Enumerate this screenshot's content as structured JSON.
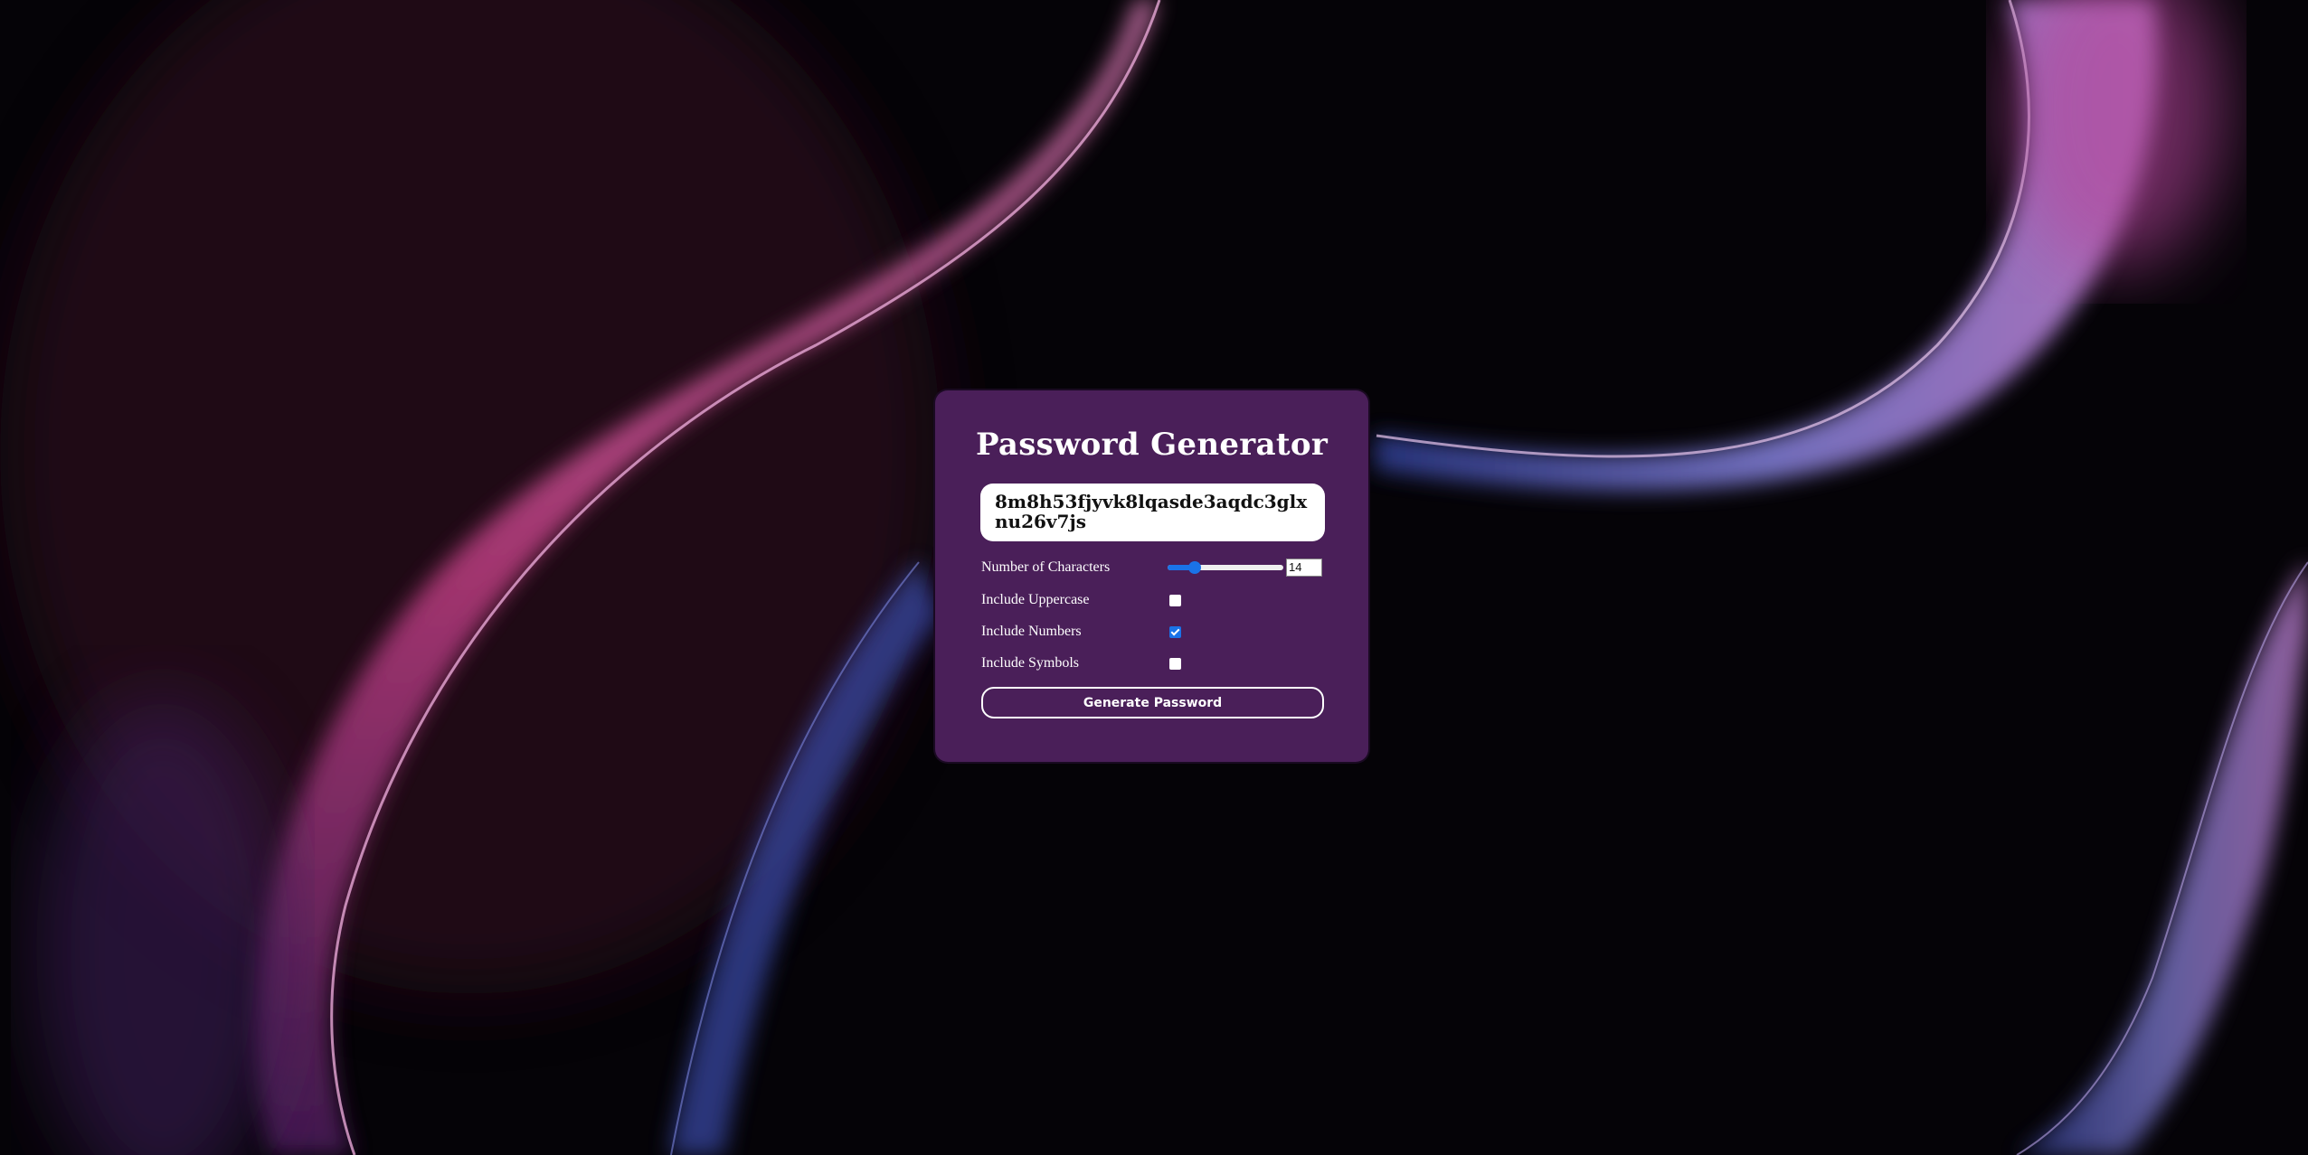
{
  "app": {
    "title": "Password Generator"
  },
  "password": {
    "value": "8m8h53fjyvk8lqasde3aqdc3glxnu26v7js"
  },
  "options": {
    "length_label": "Number of Characters",
    "length_value": "14",
    "length_slider": {
      "value": 14,
      "min": 6,
      "max": 40
    },
    "uppercase_label": "Include Uppercase",
    "uppercase_checked": false,
    "numbers_label": "Include Numbers",
    "numbers_checked": true,
    "symbols_label": "Include Symbols",
    "symbols_checked": false
  },
  "actions": {
    "generate_label": "Generate Password"
  },
  "colors": {
    "card_bg": "#4a1f59",
    "accent": "#1a73e8",
    "page_bg": "#050307"
  }
}
